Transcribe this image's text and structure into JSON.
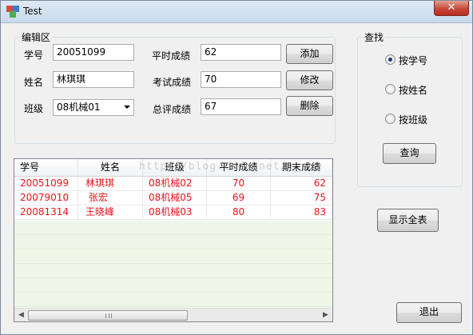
{
  "window": {
    "title": "Test",
    "close_glyph": "✕"
  },
  "edit_group": {
    "legend": "编辑区",
    "student_id": {
      "label": "学号",
      "value": "20051099"
    },
    "name": {
      "label": "姓名",
      "value": "林琪琪"
    },
    "class": {
      "label": "班级",
      "value": "08机械01"
    },
    "regular_score": {
      "label": "平时成绩",
      "value": "62"
    },
    "exam_score": {
      "label": "考试成绩",
      "value": "70"
    },
    "total_score": {
      "label": "总评成绩",
      "value": "67"
    },
    "buttons": {
      "add": "添加",
      "modify": "修改",
      "delete": "删除"
    }
  },
  "search_group": {
    "legend": "查找",
    "options": [
      {
        "label": "按学号",
        "checked": true
      },
      {
        "label": "按姓名",
        "checked": false
      },
      {
        "label": "按班级",
        "checked": false
      }
    ],
    "query_button": "查询"
  },
  "grid": {
    "columns": [
      "学号",
      "姓名",
      "班级",
      "平时成绩",
      "期末成绩"
    ],
    "rows": [
      [
        "20051099",
        "林琪琪",
        "08机械02",
        "70",
        "62"
      ],
      [
        "20079010",
        "张宏",
        "08机械05",
        "69",
        "75"
      ],
      [
        "20081314",
        "王晓峰",
        "08机械03",
        "80",
        "83"
      ]
    ],
    "row_text_color": "#e8141b",
    "watermark": "http://blog.csdn.net/y_acm",
    "scroll_left": "◀",
    "scroll_right": "▶"
  },
  "actions": {
    "show_all": "显示全表",
    "exit": "退出"
  }
}
